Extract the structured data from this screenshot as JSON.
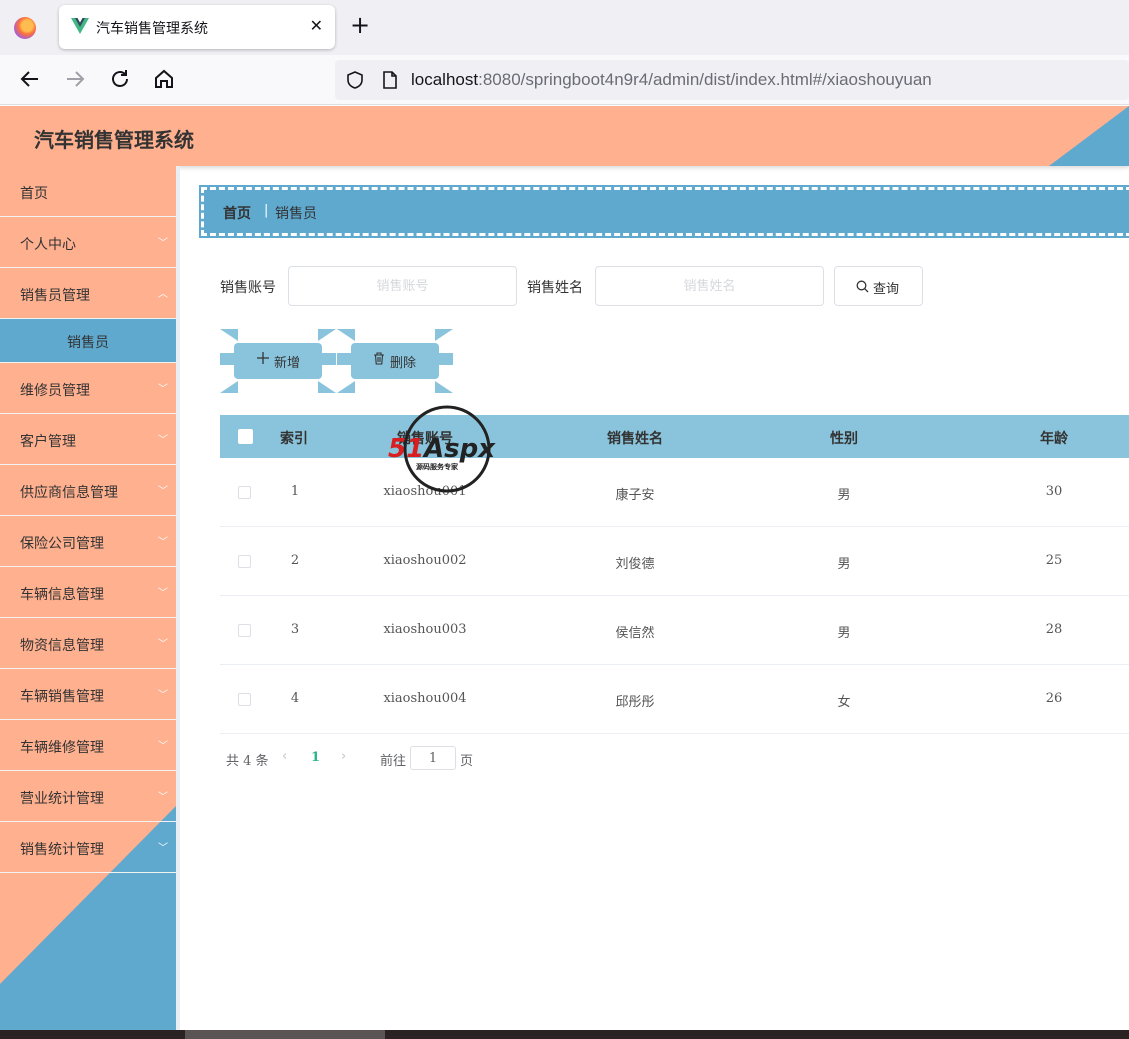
{
  "browser": {
    "tab_title": "汽车销售管理系统",
    "url_host": "localhost",
    "url_rest": ":8080/springboot4n9r4/admin/dist/index.html#/xiaoshouyuan"
  },
  "header": {
    "title": "汽车销售管理系统",
    "bg_color": "#ffb08f",
    "accent_color": "#5fa9cf"
  },
  "sidebar": {
    "items": [
      {
        "label": "首页",
        "expandable": false
      },
      {
        "label": "个人中心",
        "expandable": true
      },
      {
        "label": "销售员管理",
        "expandable": true
      },
      {
        "label": "销售员",
        "active_sub": true
      },
      {
        "label": "维修员管理",
        "expandable": true
      },
      {
        "label": "客户管理",
        "expandable": true
      },
      {
        "label": "供应商信息管理",
        "expandable": true
      },
      {
        "label": "保险公司管理",
        "expandable": true
      },
      {
        "label": "车辆信息管理",
        "expandable": true
      },
      {
        "label": "物资信息管理",
        "expandable": true
      },
      {
        "label": "车辆销售管理",
        "expandable": true
      },
      {
        "label": "车辆维修管理",
        "expandable": true
      },
      {
        "label": "营业统计管理",
        "expandable": true
      },
      {
        "label": "销售统计管理",
        "expandable": true
      }
    ]
  },
  "breadcrumb": {
    "home": "首页",
    "separator": "|",
    "current": "销售员"
  },
  "search": {
    "account_label": "销售账号",
    "account_placeholder": "销售账号",
    "name_label": "销售姓名",
    "name_placeholder": "销售姓名",
    "query_button": "查询"
  },
  "actions": {
    "add_label": "新增",
    "delete_label": "删除"
  },
  "table": {
    "columns": [
      "索引",
      "销售账号",
      "销售姓名",
      "性别",
      "年龄"
    ],
    "rows": [
      {
        "index": "1",
        "account": "xiaoshou001",
        "name": "康子安",
        "gender": "男",
        "age": "30"
      },
      {
        "index": "2",
        "account": "xiaoshou002",
        "name": "刘俊德",
        "gender": "男",
        "age": "25"
      },
      {
        "index": "3",
        "account": "xiaoshou003",
        "name": "侯信然",
        "gender": "男",
        "age": "28"
      },
      {
        "index": "4",
        "account": "xiaoshou004",
        "name": "邱彤彤",
        "gender": "女",
        "age": "26"
      }
    ]
  },
  "pagination": {
    "total_text": "共 4 条",
    "current_page": "1",
    "goto_label": "前往",
    "goto_value": "1",
    "page_unit": "页"
  },
  "watermark": {
    "brand": "51Aspx",
    "tagline": "源码服务专家"
  }
}
